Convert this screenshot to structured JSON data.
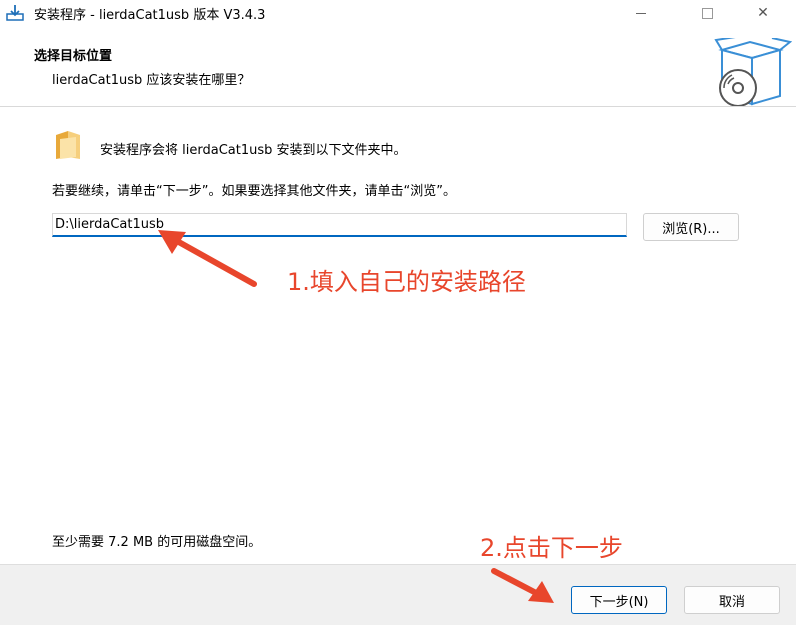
{
  "window": {
    "title": "安装程序 - lierdaCat1usb 版本 V3.4.3",
    "min_icon": "minimize-icon",
    "max_icon": "maximize-icon",
    "close_glyph": "✕"
  },
  "header": {
    "title": "选择目标位置",
    "subtitle": "lierdaCat1usb 应该安装在哪里？"
  },
  "body": {
    "info": "安装程序会将 lierdaCat1usb 安装到以下文件夹中。",
    "continue": "若要继续，请单击“下一步”。如果要选择其他文件夹，请单击“浏览”。",
    "path_value": "D:\\lierdaCat1usb",
    "browse_label": "浏览(R)...",
    "disk_space": "至少需要 7.2 MB 的可用磁盘空间。"
  },
  "footer": {
    "next_label": "下一步(N)",
    "cancel_label": "取消"
  },
  "annotations": {
    "step1": "1.填入自己的安装路径",
    "step2": "2.点击下一步",
    "color": "#e8462c"
  },
  "colors": {
    "accent": "#0067c0",
    "footer_bg": "#f0f0f0"
  }
}
